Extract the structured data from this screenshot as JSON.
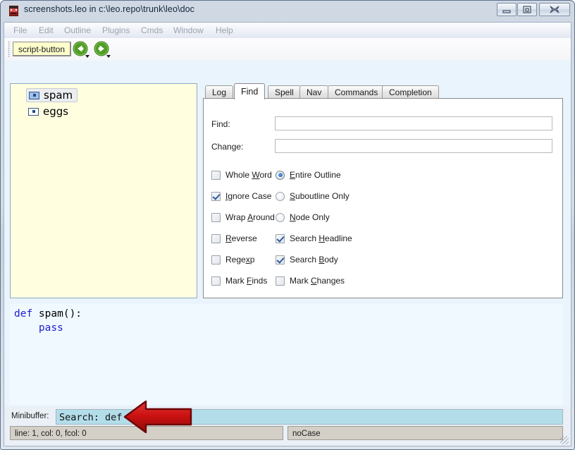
{
  "window": {
    "title": "screenshots.leo in c:\\leo.repo\\trunk\\leo\\doc",
    "icon": "leo-app-icon",
    "buttons": {
      "minimize": "minimize-icon",
      "maximize": "maximize-icon",
      "close": "close-icon"
    }
  },
  "menubar": {
    "items": [
      {
        "label": "File"
      },
      {
        "label": "Edit"
      },
      {
        "label": "Outline"
      },
      {
        "label": "Plugins"
      },
      {
        "label": "Cmds"
      },
      {
        "label": "Window"
      },
      {
        "label": "Help"
      }
    ]
  },
  "toolbar": {
    "script_button_label": "script-button",
    "back_icon": "green-back-arrow-icon",
    "forward_icon": "green-forward-arrow-icon"
  },
  "tree": {
    "nodes": [
      {
        "label": "spam",
        "selected": true
      },
      {
        "label": "eggs",
        "selected": false
      }
    ]
  },
  "notebook": {
    "tabs": [
      {
        "label": "Log",
        "active": false
      },
      {
        "label": "Find",
        "active": true
      },
      {
        "label": "Spell",
        "active": false
      },
      {
        "label": "Nav",
        "active": false
      },
      {
        "label": "Commands",
        "active": false
      },
      {
        "label": "Completion",
        "active": false
      }
    ]
  },
  "find_panel": {
    "fields": [
      {
        "label": "Find:",
        "value": "",
        "placeholder": ""
      },
      {
        "label": "Change:",
        "value": "",
        "placeholder": ""
      }
    ],
    "checkboxes_left": [
      {
        "label": "Whole Word",
        "accel": "W",
        "checked": false
      },
      {
        "label": "Ignore Case",
        "accel": "I",
        "checked": true
      },
      {
        "label": "Wrap Around",
        "accel": "A",
        "checked": false
      },
      {
        "label": "Reverse",
        "accel": "R",
        "checked": false
      },
      {
        "label": "Regexp",
        "accel": "x",
        "checked": false
      },
      {
        "label": "Mark Finds",
        "accel": "F",
        "checked": false
      }
    ],
    "radios": [
      {
        "label": "Entire Outline",
        "accel": "E",
        "checked": true
      },
      {
        "label": "Suboutline Only",
        "accel": "S",
        "checked": false
      },
      {
        "label": "Node Only",
        "accel": "N",
        "checked": false
      }
    ],
    "checkboxes_right": [
      {
        "label": "Search Headline",
        "accel": "H",
        "checked": true
      },
      {
        "label": "Search Body",
        "accel": "B",
        "checked": true
      },
      {
        "label": "Mark Changes",
        "accel": "C",
        "checked": false
      }
    ]
  },
  "body": {
    "lines": [
      {
        "keyword": "def",
        "rest": " spam():"
      },
      {
        "keyword": "",
        "rest": "    ",
        "keyword2": "pass"
      }
    ],
    "text_line1_keyword": "def",
    "text_line1_rest": " spam():",
    "text_line2_indent": "    ",
    "text_line2_keyword": "pass"
  },
  "minibuffer": {
    "label": "Minibuffer:",
    "value": "Search: def"
  },
  "status": {
    "left": "line: 1, col: 0, fcol: 0",
    "right": "noCase"
  },
  "annotation": {
    "arrow": "red-left-arrow-annotation",
    "color": "#cc1111"
  },
  "colors": {
    "tree_bg": "#ffffe0",
    "body_bg": "#f0f9ff",
    "minibuffer_bg": "#b3dde9",
    "status_bg": "#d4d0c8",
    "keyword": "#2020d0",
    "accent": "#1559a8"
  }
}
